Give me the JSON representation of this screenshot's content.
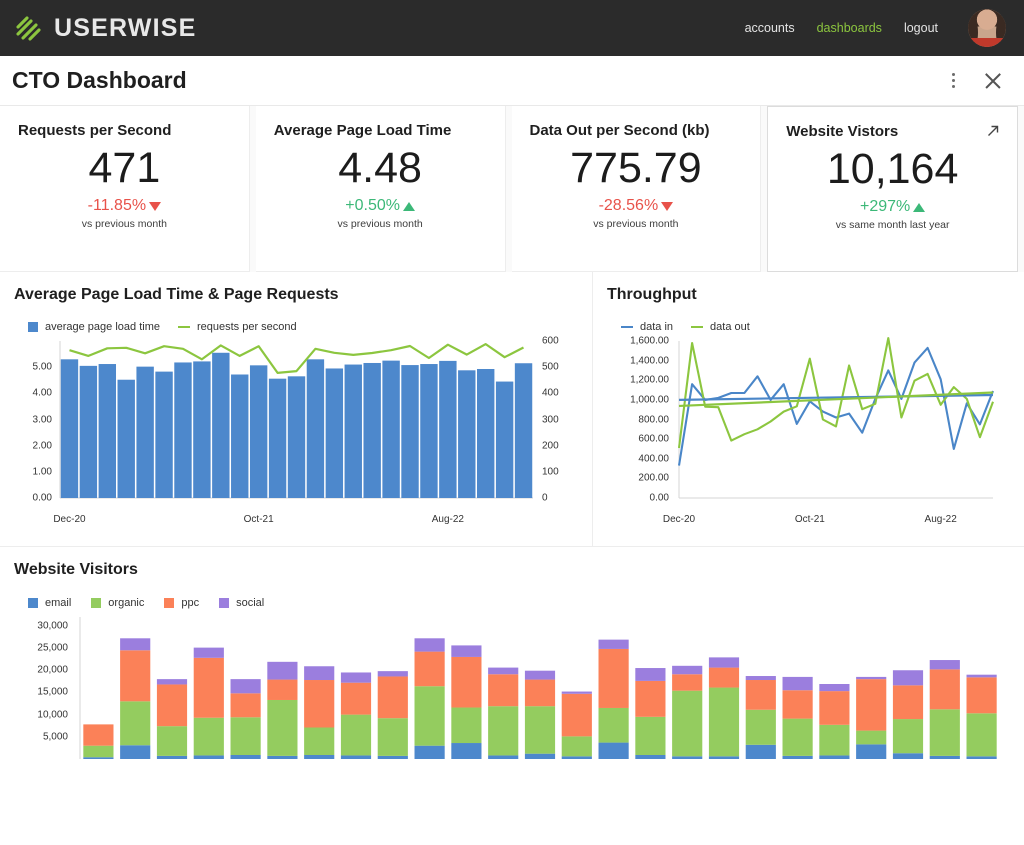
{
  "topbar": {
    "brand": "USERWISE",
    "nav": [
      {
        "label": "accounts",
        "active": false
      },
      {
        "label": "dashboards",
        "active": true
      },
      {
        "label": "logout",
        "active": false
      }
    ]
  },
  "header": {
    "title": "CTO Dashboard"
  },
  "kpis": [
    {
      "title": "Requests per Second",
      "value": "471",
      "delta": "-11.85%",
      "direction": "down",
      "sub": "vs previous month"
    },
    {
      "title": "Average Page Load Time",
      "value": "4.48",
      "delta": "+0.50%",
      "direction": "up",
      "sub": "vs previous month"
    },
    {
      "title": "Data Out per Second (kb)",
      "value": "775.79",
      "delta": "-28.56%",
      "direction": "down",
      "sub": "vs previous month"
    },
    {
      "title": "Website Vistors",
      "value": "10,164",
      "delta": "+297%",
      "direction": "up",
      "sub": "vs same month last year"
    }
  ],
  "colors": {
    "bar_blue": "#4d88cc",
    "line_green": "#8cc63f",
    "line_blue": "#4a86c8",
    "email": "#4d88cc",
    "organic": "#94cc5f",
    "ppc": "#fb8158",
    "social": "#9b7ede",
    "accent": "#8cc63f",
    "down": "#e8524a",
    "up": "#3cb878"
  },
  "chart_data": [
    {
      "type": "bar",
      "title": "Average Page Load Time & Page Requests",
      "xlabel": "",
      "ylabel": "",
      "legend": [
        {
          "label": "average page load time",
          "style": "square",
          "color": "#4d88cc"
        },
        {
          "label": "requests per second",
          "style": "line",
          "color": "#8cc63f"
        }
      ],
      "categories": [
        "Dec-20",
        "Jan-21",
        "Feb-21",
        "Mar-21",
        "Apr-21",
        "May-21",
        "Jun-21",
        "Jul-21",
        "Aug-21",
        "Sep-21",
        "Oct-21",
        "Nov-21",
        "Dec-21",
        "Jan-22",
        "Feb-22",
        "Mar-22",
        "Apr-22",
        "May-22",
        "Jun-22",
        "Jul-22",
        "Aug-22",
        "Sep-22",
        "Oct-22",
        "Nov-22",
        "Dec-22"
      ],
      "xticks": [
        "Dec-20",
        "Oct-21",
        "Aug-22"
      ],
      "xtick_index": [
        0,
        10,
        20
      ],
      "ylim": [
        0,
        6
      ],
      "yticks": [
        "0.00",
        "1.00",
        "2.00",
        "3.00",
        "4.00",
        "5.00"
      ],
      "y2lim": [
        0,
        600
      ],
      "y2ticks": [
        "0",
        "100",
        "200",
        "300",
        "400",
        "500",
        "600"
      ],
      "series": [
        {
          "name": "average page load time",
          "axis": "left",
          "color": "#4d88cc",
          "values": [
            5.3,
            5.05,
            5.12,
            4.52,
            5.02,
            4.83,
            5.18,
            5.22,
            5.55,
            4.72,
            5.07,
            4.56,
            4.65,
            5.3,
            4.95,
            5.1,
            5.16,
            5.25,
            5.08,
            5.12,
            5.24,
            4.88,
            4.93,
            4.45,
            5.15
          ]
        },
        {
          "name": "requests per second",
          "axis": "right",
          "color": "#8cc63f",
          "values": [
            565,
            543,
            572,
            574,
            553,
            580,
            570,
            530,
            583,
            543,
            580,
            478,
            485,
            570,
            555,
            547,
            554,
            565,
            581,
            535,
            586,
            548,
            588,
            538,
            575
          ]
        }
      ]
    },
    {
      "type": "line",
      "title": "Throughput",
      "xlabel": "",
      "ylabel": "",
      "legend": [
        {
          "label": "data in",
          "style": "line",
          "color": "#4a86c8"
        },
        {
          "label": "data out",
          "style": "line",
          "color": "#8cc63f"
        }
      ],
      "categories": [
        "Dec-20",
        "Jan-21",
        "Feb-21",
        "Mar-21",
        "Apr-21",
        "May-21",
        "Jun-21",
        "Jul-21",
        "Aug-21",
        "Sep-21",
        "Oct-21",
        "Nov-21",
        "Dec-21",
        "Jan-22",
        "Feb-22",
        "Mar-22",
        "Apr-22",
        "May-22",
        "Jun-22",
        "Jul-22",
        "Aug-22",
        "Sep-22",
        "Oct-22",
        "Nov-22",
        "Dec-22"
      ],
      "xticks": [
        "Dec-20",
        "Oct-21",
        "Aug-22"
      ],
      "xtick_index": [
        0,
        10,
        20
      ],
      "ylim": [
        0,
        1600
      ],
      "yticks": [
        "0.00",
        "200.00",
        "400.00",
        "600.00",
        "800.00",
        "1,000.00",
        "1,200.00",
        "1,400.00",
        "1,600.00"
      ],
      "series": [
        {
          "name": "data in",
          "color": "#4a86c8",
          "values": [
            330,
            1160,
            1000,
            1020,
            1070,
            1070,
            1240,
            1000,
            1160,
            755,
            985,
            880,
            820,
            860,
            665,
            1010,
            1300,
            1010,
            1380,
            1530,
            1210,
            500,
            965,
            750,
            1090
          ]
        },
        {
          "name": "data out",
          "color": "#8cc63f",
          "values": [
            510,
            1580,
            930,
            925,
            585,
            650,
            700,
            780,
            880,
            935,
            1420,
            800,
            730,
            1350,
            905,
            960,
            1630,
            820,
            1195,
            1265,
            950,
            1130,
            1010,
            620,
            980
          ]
        },
        {
          "name": "data in trend",
          "color": "#4a86c8",
          "trend": true,
          "values": [
            1000,
            1050
          ]
        },
        {
          "name": "data out trend",
          "color": "#8cc63f",
          "trend": true,
          "values": [
            938,
            1075
          ]
        }
      ]
    },
    {
      "type": "bar",
      "stacked": true,
      "title": "Website Visitors",
      "xlabel": "",
      "ylabel": "",
      "legend": [
        {
          "label": "email",
          "style": "square",
          "color": "#4d88cc"
        },
        {
          "label": "organic",
          "style": "square",
          "color": "#94cc5f"
        },
        {
          "label": "ppc",
          "style": "square",
          "color": "#fb8158"
        },
        {
          "label": "social",
          "style": "square",
          "color": "#9b7ede"
        }
      ],
      "categories": [
        "Dec-20",
        "Jan-21",
        "Feb-21",
        "Mar-21",
        "Apr-21",
        "May-21",
        "Jun-21",
        "Jul-21",
        "Aug-21",
        "Sep-21",
        "Oct-21",
        "Nov-21",
        "Dec-21",
        "Jan-22",
        "Feb-22",
        "Mar-22",
        "Apr-22",
        "May-22",
        "Jun-22",
        "Jul-22",
        "Aug-22",
        "Sep-22",
        "Oct-22",
        "Nov-22",
        "Dec-22"
      ],
      "ylim": [
        0,
        32000
      ],
      "yticks": [
        "5,000",
        "10,000",
        "15,000",
        "20,000",
        "25,000",
        "30,000"
      ],
      "series": [
        {
          "name": "email",
          "color": "#4d88cc",
          "values": [
            400,
            3100,
            700,
            800,
            900,
            700,
            900,
            800,
            700,
            3000,
            3600,
            800,
            1200,
            600,
            3700,
            900,
            600,
            600,
            3200,
            700,
            800,
            3300,
            1300,
            700,
            600
          ]
        },
        {
          "name": "organic",
          "color": "#94cc5f",
          "values": [
            2600,
            9900,
            6700,
            8500,
            8500,
            12600,
            6200,
            9200,
            8500,
            13400,
            8000,
            11100,
            10700,
            4500,
            7800,
            8600,
            14800,
            15500,
            7900,
            8400,
            6900,
            3100,
            7700,
            10500,
            9700
          ]
        },
        {
          "name": "ppc",
          "color": "#fb8158",
          "values": [
            4800,
            11500,
            9400,
            13500,
            5400,
            4600,
            10700,
            7200,
            9400,
            7800,
            11400,
            7200,
            6000,
            9600,
            13300,
            8100,
            3700,
            4500,
            6700,
            6400,
            7600,
            11600,
            7600,
            9000,
            8100
          ]
        },
        {
          "name": "social",
          "color": "#9b7ede",
          "values": [
            0,
            2700,
            1200,
            2300,
            3200,
            4000,
            3100,
            2300,
            1200,
            3000,
            2600,
            1500,
            2000,
            500,
            2100,
            2900,
            1900,
            2300,
            900,
            3000,
            1600,
            500,
            3400,
            2100,
            600
          ]
        }
      ]
    }
  ]
}
